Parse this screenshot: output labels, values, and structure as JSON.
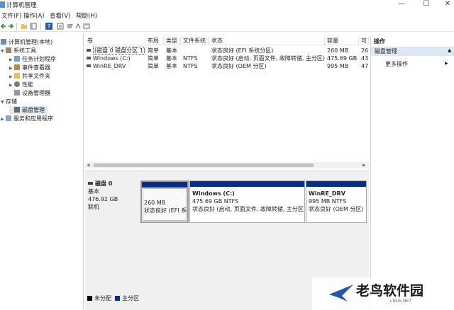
{
  "window": {
    "title": "计算机管理",
    "min_glyph": "—",
    "max_glyph": "☐",
    "close_glyph": "✕"
  },
  "menu": [
    "文件(F)",
    "操作(A)",
    "查看(V)",
    "帮助(H)"
  ],
  "tree": {
    "root": "计算机管理(本地)",
    "system_tools": "系统工具",
    "task_scheduler": "任务计划程序",
    "event_viewer": "事件查看器",
    "shared_folders": "共享文件夹",
    "performance": "性能",
    "device_manager": "设备管理器",
    "storage": "存储",
    "disk_management": "磁盘管理",
    "services": "服务和应用程序"
  },
  "list": {
    "columns": [
      "卷",
      "布局",
      "类型",
      "文件系统",
      "状态",
      "容量",
      "可"
    ],
    "rows": [
      [
        "(磁盘 0 磁盘分区 1)",
        "简单",
        "基本",
        "",
        "状态良好 (EFI 系统分区)",
        "260 MB",
        "26"
      ],
      [
        "Windows (C:)",
        "简单",
        "基本",
        "NTFS",
        "状态良好 (启动, 页面文件, 故障转储, 主分区)",
        "475.69 GB",
        "43"
      ],
      [
        "WinRE_DRV",
        "简单",
        "基本",
        "NTFS",
        "状态良好 (OEM 分区)",
        "995 MB",
        "47"
      ]
    ]
  },
  "disk": {
    "name": "磁盘 0",
    "type": "基本",
    "size": "476.92 GB",
    "status": "联机"
  },
  "partitions": [
    {
      "title": "",
      "size": "260 MB",
      "status": "状态良好 (EFI 系"
    },
    {
      "title": "Windows (C:)",
      "size": "475.69 GB NTFS",
      "status": "状态良好 (启动, 页面文件, 故障转储, 主分区"
    },
    {
      "title": "WinRE_DRV",
      "size": "995 MB NTFS",
      "status": "状态良好 (OEM 分区)"
    }
  ],
  "legend": {
    "unallocated": "未分配",
    "primary": "主分区"
  },
  "actions": {
    "title": "操作",
    "section": "磁盘管理",
    "more": "更多操作"
  },
  "watermark": {
    "brand": "老鸟软件园",
    "url": "LNUS.NET"
  },
  "colors": {
    "partition_band": "#0a2d7d",
    "selection": "#dde8f3",
    "unallocated": "#000000"
  }
}
